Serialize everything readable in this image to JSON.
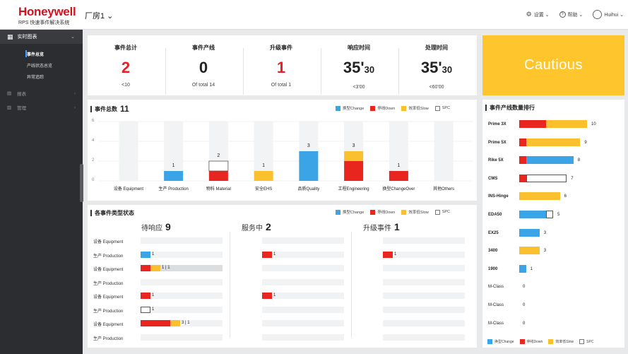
{
  "header": {
    "brand": "Honeywell",
    "subtitle": "RPS 快速事件解决系统",
    "plant_label": "厂房1 ⌄",
    "settings": "设置 ⌄",
    "help": "帮助 ⌄",
    "user": "Huihui ⌄"
  },
  "sidebar": {
    "main_label": "实时图表",
    "sub_items": [
      "事件总览",
      "产线状态总览",
      "异常追踪"
    ],
    "items": [
      "报表",
      "管理"
    ]
  },
  "kpis": [
    {
      "label": "事件总计",
      "value": "2",
      "sub": "<10",
      "color": "#e8202a"
    },
    {
      "label": "事件产线",
      "value": "0",
      "sub": "Of total 14",
      "color": "#111111"
    },
    {
      "label": "升级事件",
      "value": "1",
      "sub": "Of total 1",
      "color": "#e8202a"
    },
    {
      "label": "响应时间",
      "value_main": "35'",
      "value_sub": "30",
      "sub": "<3'00",
      "color": "#111111"
    },
    {
      "label": "处理时间",
      "value_main": "35'",
      "value_sub": "30",
      "sub": "<60'00",
      "color": "#111111"
    }
  ],
  "status_banner": {
    "text": "Cautious",
    "color": "#ffc52c"
  },
  "legend": {
    "change": "换型Change",
    "down": "停线Down",
    "slow": "效率低Slow",
    "spc": "SPC"
  },
  "colors": {
    "change": "#3aa4e6",
    "down": "#e8251f",
    "slow": "#fbc02d",
    "spc": "#ffffff"
  },
  "total_chart": {
    "title": "事件总数",
    "total": "11",
    "y_ticks": [
      "6",
      "4",
      "2",
      "0"
    ]
  },
  "chart_data": {
    "type": "bar",
    "stacked": true,
    "title": "事件总数",
    "categories": [
      "设备 Equipment",
      "生产 Production",
      "物料 Material",
      "安全EHS",
      "品质Quality",
      "工程Engineering",
      "换型ChangeOver",
      "其他Others"
    ],
    "series": [
      {
        "name": "换型Change",
        "values": [
          0,
          1,
          0,
          0,
          3,
          0,
          0,
          0
        ]
      },
      {
        "name": "停线Down",
        "values": [
          0,
          0,
          1,
          0,
          0,
          2,
          1,
          0
        ]
      },
      {
        "name": "效率低Slow",
        "values": [
          0,
          0,
          0,
          1,
          0,
          1,
          0,
          0
        ]
      },
      {
        "name": "SPC",
        "values": [
          0,
          0,
          1,
          0,
          0,
          0,
          0,
          0
        ]
      }
    ],
    "totals": [
      "",
      "1",
      "2",
      "1",
      "3",
      "3",
      "1",
      ""
    ],
    "ylim": [
      0,
      6
    ],
    "grid": true
  },
  "status_section": {
    "title": "各事件类型状态",
    "columns": [
      {
        "head": "待响应",
        "count": "9"
      },
      {
        "head": "服务中",
        "count": "2"
      },
      {
        "head": "升级事件",
        "count": "1"
      }
    ],
    "rows": [
      {
        "label": "设备 Equipment"
      },
      {
        "label": "生产 Production"
      },
      {
        "label": "设备 Equipment"
      },
      {
        "label": "生产 Production"
      },
      {
        "label": "设备 Equipment"
      },
      {
        "label": "生产 Production"
      },
      {
        "label": "设备 Equipment"
      },
      {
        "label": "生产 Production"
      }
    ],
    "pending": [
      null,
      {
        "segments": [
          {
            "c": "change",
            "v": 1
          }
        ],
        "text": "1"
      },
      {
        "segments": [
          {
            "c": "down",
            "v": 1
          },
          {
            "c": "slow",
            "v": 1
          }
        ],
        "text": "1 | 1",
        "track": true
      },
      null,
      {
        "segments": [
          {
            "c": "down",
            "v": 1
          }
        ],
        "text": "1"
      },
      {
        "segments": [
          {
            "c": "spc",
            "v": 1
          }
        ],
        "text": "1"
      },
      {
        "segments": [
          {
            "c": "down",
            "v": 3
          },
          {
            "c": "slow",
            "v": 1
          }
        ],
        "text": "3 | 1"
      },
      null
    ],
    "in_service": [
      null,
      {
        "segments": [
          {
            "c": "down",
            "v": 1
          }
        ],
        "text": "1"
      },
      null,
      null,
      {
        "segments": [
          {
            "c": "down",
            "v": 1
          }
        ],
        "text": "1"
      },
      null,
      null,
      null
    ],
    "escalated": [
      null,
      {
        "segments": [
          {
            "c": "down",
            "v": 1
          }
        ],
        "text": "1"
      },
      null,
      null,
      null,
      null,
      null,
      null
    ]
  },
  "ranking": {
    "title": "事件产线数量排行",
    "items": [
      {
        "name": "Prime 3X",
        "segments": [
          {
            "c": "down",
            "v": 4
          },
          {
            "c": "slow",
            "v": 6
          }
        ],
        "total": "10"
      },
      {
        "name": "Prime 5X",
        "segments": [
          {
            "c": "down",
            "v": 1
          },
          {
            "c": "slow",
            "v": 8
          }
        ],
        "total": "9"
      },
      {
        "name": "Rike 5X",
        "segments": [
          {
            "c": "down",
            "v": 1
          },
          {
            "c": "change",
            "v": 7
          }
        ],
        "total": "8"
      },
      {
        "name": "CMS",
        "segments": [
          {
            "c": "down",
            "v": 1
          },
          {
            "c": "spc",
            "v": 6
          }
        ],
        "total": "7"
      },
      {
        "name": "INS-Hinge",
        "segments": [
          {
            "c": "slow",
            "v": 6
          }
        ],
        "total": "6"
      },
      {
        "name": "EDA50",
        "segments": [
          {
            "c": "change",
            "v": 4
          },
          {
            "c": "spc",
            "v": 1
          }
        ],
        "total": "5"
      },
      {
        "name": "EX25",
        "segments": [
          {
            "c": "change",
            "v": 3
          }
        ],
        "total": "3"
      },
      {
        "name": "3400",
        "segments": [
          {
            "c": "slow",
            "v": 3
          }
        ],
        "total": "3"
      },
      {
        "name": "1900",
        "segments": [
          {
            "c": "change",
            "v": 1
          }
        ],
        "total": "1"
      },
      {
        "name": "M-Class",
        "segments": [],
        "total": "0"
      },
      {
        "name": "M-Class",
        "segments": [],
        "total": "0"
      },
      {
        "name": "M-Class",
        "segments": [],
        "total": "0"
      }
    ]
  }
}
